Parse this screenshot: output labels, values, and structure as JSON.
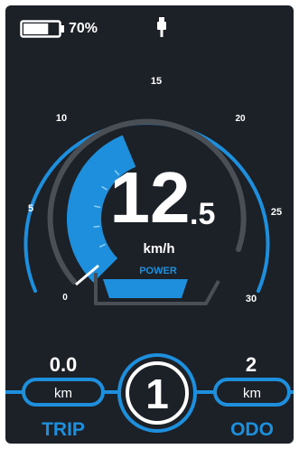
{
  "status": {
    "battery_percent_text": "70%",
    "battery_level": 0.7,
    "usb_icon": "usb-plug-icon"
  },
  "speed": {
    "integer": "12",
    "decimal": ".5",
    "unit": "km/h",
    "mode_label": "POWER",
    "gauge_ticks": [
      "0",
      "5",
      "10",
      "15",
      "20",
      "25",
      "30"
    ],
    "speed_value": 12.5,
    "speed_max": 30
  },
  "trip": {
    "value": "0.0",
    "unit": "km",
    "label": "TRIP"
  },
  "odo": {
    "value": "2",
    "unit": "km",
    "label": "ODO"
  },
  "assist": {
    "level": "1"
  },
  "colors": {
    "background": "#1c2128",
    "accent": "#1e8fdc",
    "accent_light": "#52b4f0",
    "track": "#4a4f55",
    "text": "#ffffff"
  }
}
